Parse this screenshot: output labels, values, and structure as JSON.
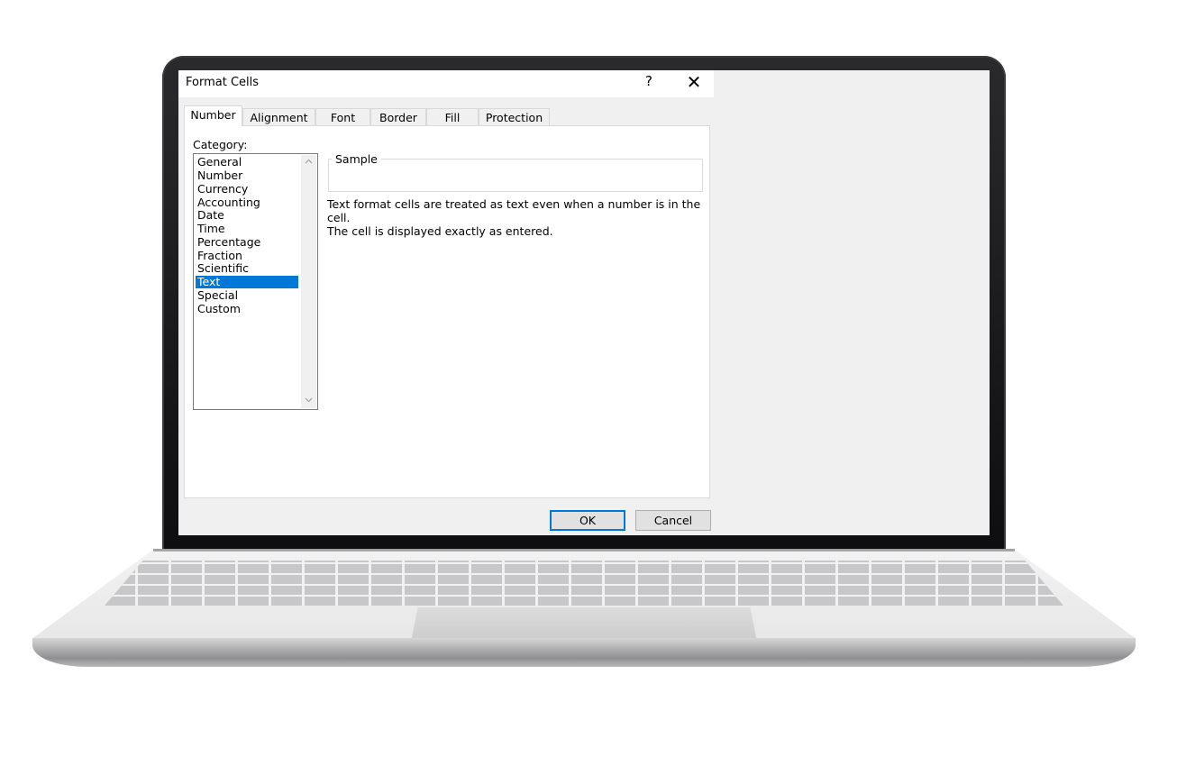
{
  "dialog": {
    "title": "Format Cells",
    "help_glyph": "?",
    "close_glyph": "✕",
    "tabs": [
      {
        "label": "Number",
        "active": true
      },
      {
        "label": "Alignment",
        "active": false
      },
      {
        "label": "Font",
        "active": false
      },
      {
        "label": "Border",
        "active": false
      },
      {
        "label": "Fill",
        "active": false
      },
      {
        "label": "Protection",
        "active": false
      }
    ],
    "category_label": "Category:",
    "categories": [
      "General",
      "Number",
      "Currency",
      "Accounting",
      "Date",
      "Time",
      "Percentage",
      "Fraction",
      "Scientific",
      "Text",
      "Special",
      "Custom"
    ],
    "selected_category": "Text",
    "sample_label": "Sample",
    "description_lines": [
      "Text format cells are treated as text even when a number is in the cell.",
      "The cell is displayed exactly as entered."
    ],
    "ok_label": "OK",
    "cancel_label": "Cancel"
  },
  "colors": {
    "selection": "#0078d7",
    "dialog_bg": "#f0f0f0",
    "panel_bg": "#ffffff"
  },
  "icons": {
    "help": "help-icon",
    "close": "close-icon",
    "scroll_up": "chevron-up-icon",
    "scroll_down": "chevron-down-icon"
  }
}
